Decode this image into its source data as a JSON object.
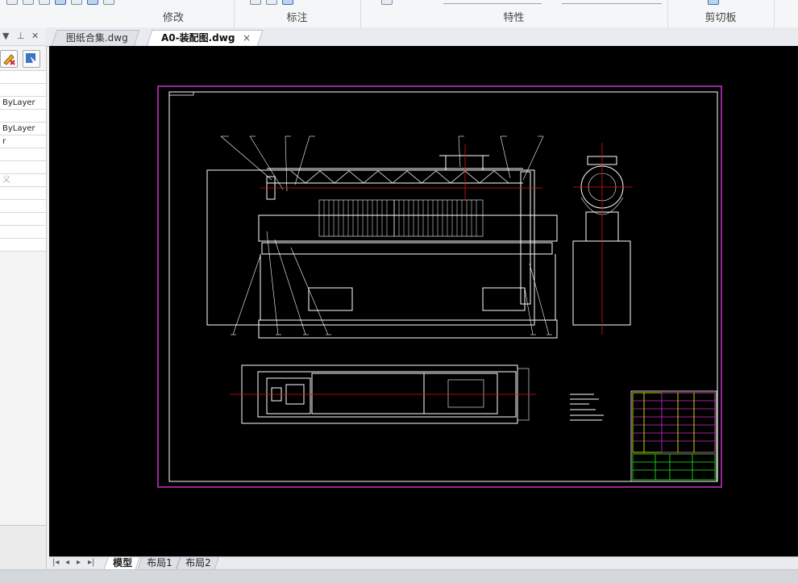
{
  "ribbon": {
    "groups": [
      {
        "label": "修改"
      },
      {
        "label": "标注"
      },
      {
        "label": "特性"
      },
      {
        "label": "剪切板"
      }
    ]
  },
  "palette": {
    "header_icons": [
      "pin-icon",
      "close-icon"
    ],
    "rows": [
      "",
      "",
      "ByLayer",
      "",
      "ByLayer",
      "r",
      "",
      "",
      "义",
      "",
      "",
      "",
      "",
      ""
    ]
  },
  "tabs": [
    {
      "label": "图纸合集.dwg",
      "active": false
    },
    {
      "label": "A0-装配图.dwg",
      "active": true,
      "close": "×"
    }
  ],
  "layout_tabs": [
    {
      "label": "模型",
      "active": true
    },
    {
      "label": "布局1",
      "active": false
    },
    {
      "label": "布局2",
      "active": false
    }
  ],
  "drawing": {
    "content": "A0 screw conveyor assembly drawing with elevation, side and plan views, callout leaders, notes and title block"
  },
  "colors": {
    "canvas_bg": "#000000",
    "frame": "#c832c8",
    "centerline": "#e01010",
    "geometry": "#ffffff",
    "title_block_table": "#ffff00",
    "title_block_green": "#22ee22"
  }
}
